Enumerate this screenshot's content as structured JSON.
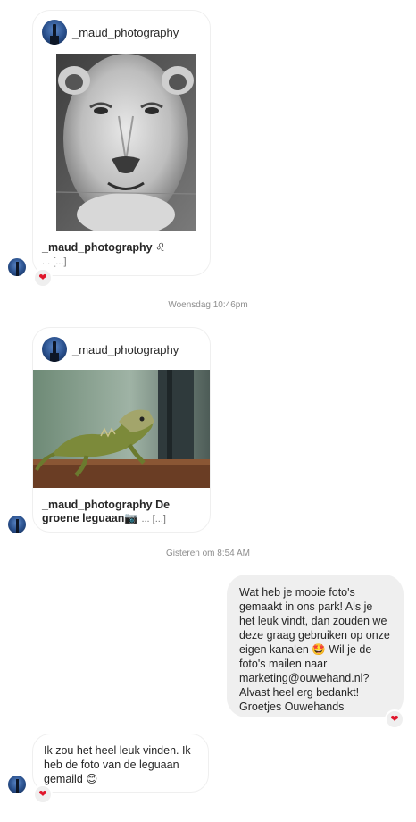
{
  "posts": [
    {
      "username": "_maud_photography",
      "caption_user": "_maud_photography",
      "caption_text": " ♌",
      "caption_more": "... [...]",
      "image_alt": "lioness black and white photo"
    },
    {
      "username": "_maud_photography",
      "caption_user": "_maud_photography",
      "caption_text": " De groene leguaan📷",
      "caption_more": "... [...]",
      "image_alt": "green iguana on wooden rail"
    }
  ],
  "timestamps": {
    "first": "Woensdag 10:46pm",
    "second": "Gisteren om 8:54 AM"
  },
  "messages": {
    "outgoing": "Wat heb je mooie foto's gemaakt in ons park! Als je het leuk vindt, dan zouden we deze graag gebruiken op onze eigen kanalen 🤩 Wil je de foto's mailen naar marketing@ouwehand.nl? Alvast heel erg bedankt! Groetjes Ouwehands",
    "incoming": "Ik zou het heel leuk vinden. Ik heb de foto van de leguaan gemaild 😊"
  },
  "reactions": {
    "heart": "❤"
  },
  "colors": {
    "heart": "#e0162b",
    "bubble_out": "#efefef",
    "timestamp": "#8e8e8e"
  }
}
